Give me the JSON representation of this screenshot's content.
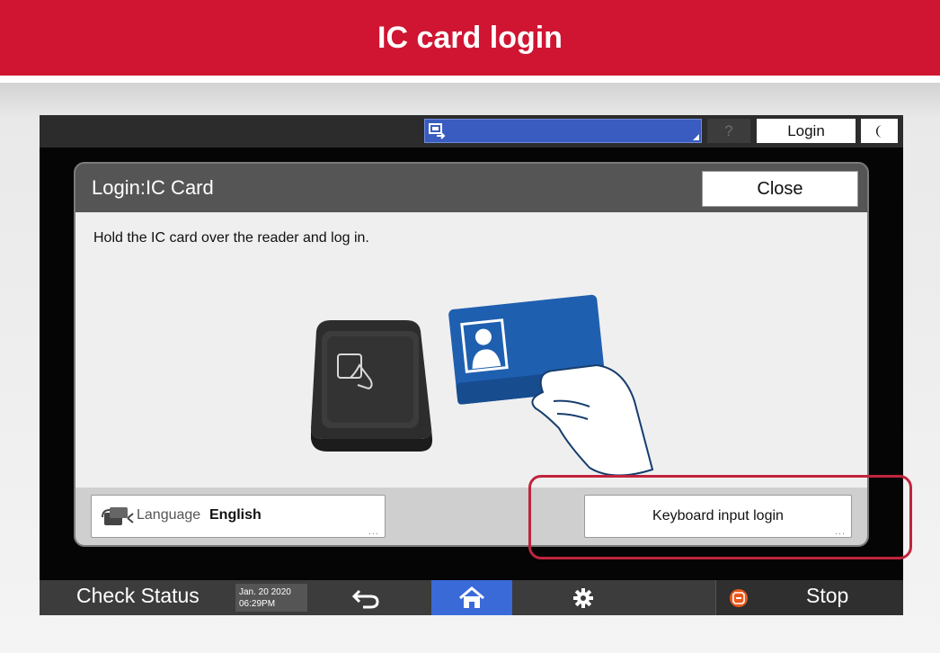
{
  "banner": {
    "title": "IC card login"
  },
  "topbar": {
    "status_icon": "copier-status-icon",
    "help_label": "?",
    "login_label": "Login",
    "sleep_icon": "moon-icon"
  },
  "dialog": {
    "title": "Login:IC Card",
    "close_label": "Close",
    "instruction": "Hold the IC card over the reader and log in.",
    "illustration": "ic-card-reader-illustration",
    "language": {
      "label": "Language",
      "value": "English",
      "icon": "language-switch-icon",
      "more": "..."
    },
    "keyboard_login": {
      "label": "Keyboard input login",
      "more": "..."
    }
  },
  "bottombar": {
    "check_status_label": "Check Status",
    "date": "Jan. 20 2020",
    "time": "06:29PM",
    "back_icon": "back-arrow-icon",
    "home_icon": "home-icon",
    "settings_icon": "gear-icon",
    "stop_icon": "stop-icon",
    "stop_label": "Stop"
  },
  "colors": {
    "banner": "#cf1532",
    "highlight": "#c0243e",
    "home_active": "#3a69d8",
    "status_area": "#3a5cc0",
    "card_blue": "#1f5fb0",
    "stop_orange": "#e8581c"
  }
}
